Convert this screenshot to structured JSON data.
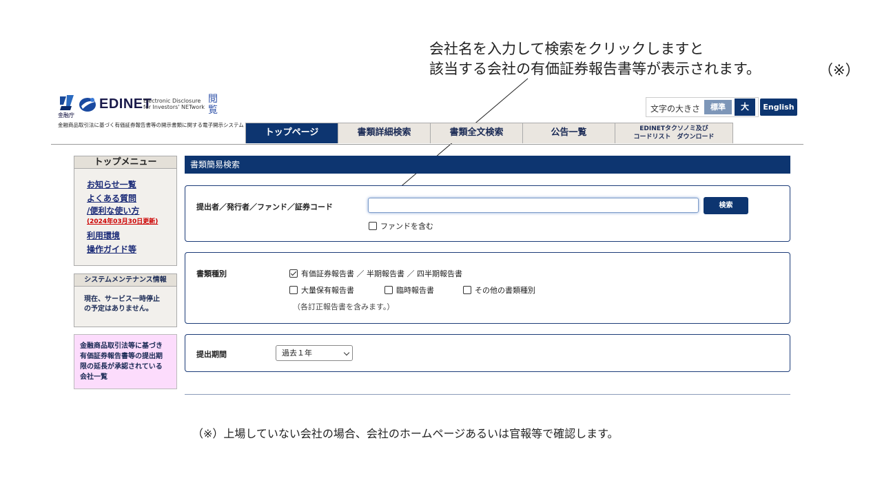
{
  "annotation": {
    "top_line1": "会社名を入力して検索をクリックしますと",
    "top_line2": "該当する会社の有価証券報告書等が表示されます。",
    "top_note": "（※）",
    "bottom": "（※）上場していない会社の場合、会社のホームページあるいは官報等で確認します。"
  },
  "logo": {
    "agency": "金融庁",
    "name": "EDINET",
    "sub_line1": "Electronic Disclosure",
    "sub_line2": "for Investors' NETwork",
    "etsu": "閲覧",
    "desc": "金融商品取引法に基づく有価証券報告書等の開示書類に関する電子開示システム"
  },
  "font_size": {
    "label": "文字の大きさ",
    "standard": "標準",
    "large": "大"
  },
  "english_label": "English",
  "nav": {
    "tabs": [
      {
        "label": "トップページ"
      },
      {
        "label": "書類詳細検索"
      },
      {
        "label": "書類全文検索"
      },
      {
        "label": "公告一覧"
      }
    ],
    "taxonomy_line1": "EDINETタクソノミ及び",
    "taxonomy_line2": "コードリスト　ダウンロード"
  },
  "sidebar": {
    "menu_title": "トップメニュー",
    "links": {
      "news": "お知らせ一覧",
      "faq1": "よくある質問",
      "faq2": "/便利な使い方",
      "faq_updated": "(2024年03月30日更新)",
      "env": "利用環境",
      "guide": "操作ガイド等"
    },
    "maint_title": "システムメンテナンス情報",
    "maint_line1": "現在、サービス一時停止",
    "maint_line2": "の予定はありません。",
    "pink_line1": "金融商品取引法等に基づき",
    "pink_line2": "有価証券報告書等の提出期",
    "pink_line3": "限の延長が承認されている",
    "pink_line4": "会社一覧"
  },
  "main": {
    "header": "書類簡易検索",
    "search_label": "提出者／発行者／ファンド／証券コード",
    "search_value": "",
    "search_button": "検索",
    "fund_checkbox": "ファンドを含む",
    "doc_type_label": "書類種別",
    "doc_types": {
      "securities": "有価証券報告書 ／ 半期報告書 ／ 四半期報告書",
      "large_holding": "大量保有報告書",
      "extraordinary": "臨時報告書",
      "other": "その他の書類種別"
    },
    "doc_note": "（各訂正報告書を含みます。）",
    "period_label": "提出期間",
    "period_value": "過去１年"
  }
}
